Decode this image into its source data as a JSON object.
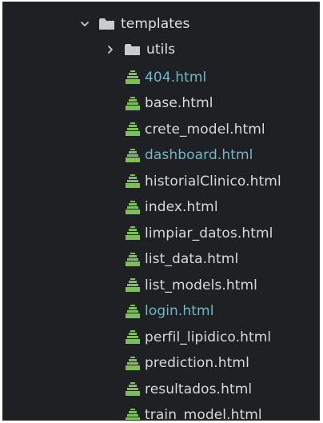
{
  "explorer": {
    "root_folder": {
      "label": "templates",
      "expanded": true
    },
    "subfolders": [
      {
        "label": "utils",
        "expanded": false
      }
    ],
    "files": [
      {
        "label": "404.html",
        "color": "#6fb7c8"
      },
      {
        "label": "base.html",
        "color": "#d9d9d9"
      },
      {
        "label": "crete_model.html",
        "color": "#d9d9d9"
      },
      {
        "label": "dashboard.html",
        "color": "#6fb7c8"
      },
      {
        "label": "historialClinico.html",
        "color": "#d9d9d9"
      },
      {
        "label": "index.html",
        "color": "#d9d9d9"
      },
      {
        "label": "limpiar_datos.html",
        "color": "#d9d9d9"
      },
      {
        "label": "list_data.html",
        "color": "#d9d9d9"
      },
      {
        "label": "list_models.html",
        "color": "#d9d9d9"
      },
      {
        "label": "login.html",
        "color": "#6fb7c8"
      },
      {
        "label": "perfil_lipidico.html",
        "color": "#d9d9d9"
      },
      {
        "label": "prediction.html",
        "color": "#d9d9d9"
      },
      {
        "label": "resultados.html",
        "color": "#d9d9d9"
      },
      {
        "label": "train_model.html",
        "color": "#d9d9d9"
      }
    ],
    "icons": {
      "expanded": "chevron-down-icon",
      "collapsed": "chevron-right-icon",
      "folder": "folder-icon",
      "file": "html-file-icon"
    },
    "colors": {
      "background": "#1f2023",
      "text": "#d9d9d9",
      "highlight_text": "#6fb7c8",
      "folder": "#c9cbcf",
      "file_icon": "#7fbf5a"
    }
  }
}
